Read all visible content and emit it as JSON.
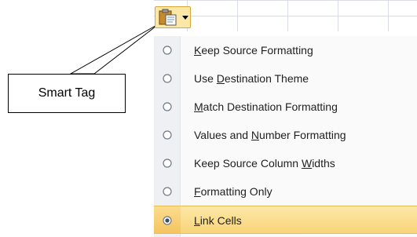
{
  "menu": {
    "items": [
      {
        "label": "Keep Source Formatting",
        "selected": false
      },
      {
        "label": "Use Destination Theme",
        "selected": false
      },
      {
        "label": "Match Destination Formatting",
        "selected": false
      },
      {
        "label": "Values and Number Formatting",
        "selected": false
      },
      {
        "label": "Keep Source Column Widths",
        "selected": false
      },
      {
        "label": "Formatting Only",
        "selected": false
      },
      {
        "label": "Link Cells",
        "selected": true
      }
    ]
  },
  "callout": {
    "label": "Smart Tag"
  },
  "icons": {
    "smart_tag_button": "clipboard-icon",
    "dropdown": "chevron-down-icon",
    "option": "radio-icon"
  },
  "colors": {
    "highlight": "#f8d47a",
    "gutter": "#eef0f3",
    "tag_button": "#fbe8a8"
  }
}
